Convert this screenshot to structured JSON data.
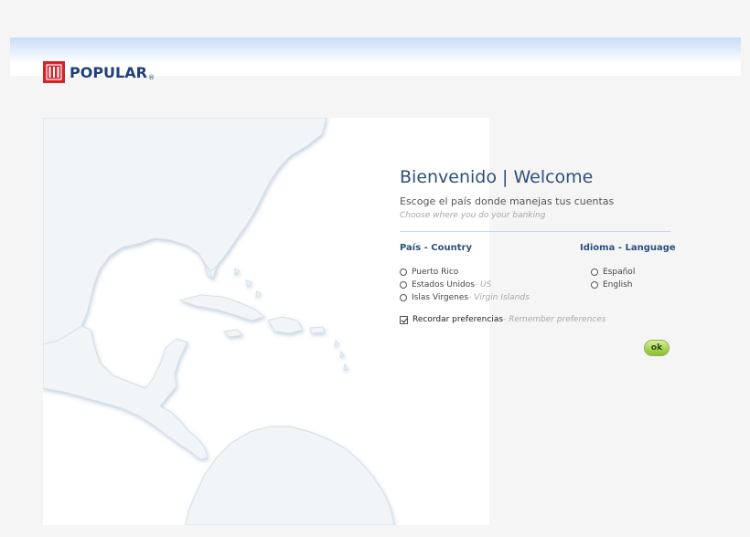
{
  "brand": {
    "name": "POPULAR",
    "registered": "®",
    "icon": "popular-logo-icon",
    "color_red": "#d1232a",
    "color_navy": "#1f3f7a"
  },
  "welcome": {
    "title": "Bienvenido | Welcome",
    "subtitle_es": "Escoge el país donde manejas tus cuentas",
    "subtitle_en": "Choose where you do your banking"
  },
  "country": {
    "heading": "País - Country",
    "options": [
      {
        "label": "Puerto Rico",
        "label_en": ""
      },
      {
        "label": "Estados Unidos",
        "label_en": " - US"
      },
      {
        "label": "Islas Virgenes",
        "label_en": " - Virgin Islands"
      }
    ]
  },
  "language": {
    "heading": "Idioma - Language",
    "options": [
      {
        "label": "Español"
      },
      {
        "label": "English"
      }
    ]
  },
  "remember": {
    "label": "Recordar preferencias",
    "label_en": " - Remember preferences",
    "checked": true
  },
  "submit": {
    "label": "ok",
    "color": "#a9d454"
  },
  "map": {
    "icon": "caribbean-map-illustration"
  }
}
